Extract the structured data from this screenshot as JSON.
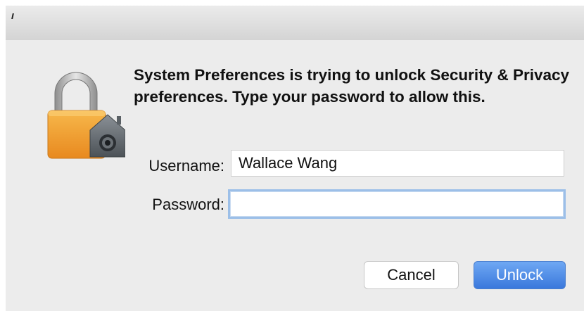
{
  "dialog": {
    "message": "System Preferences is trying to unlock Security & Privacy preferences. Type your password to allow this.",
    "username_label": "Username:",
    "username_value": "Wallace Wang",
    "password_label": "Password:",
    "password_value": "",
    "cancel_label": "Cancel",
    "unlock_label": "Unlock",
    "icon": "lock-icon"
  },
  "colors": {
    "lock_body": "#f2a23a",
    "unlock_button": "#4a8cf0",
    "focus_ring": "#9cbfe8"
  }
}
